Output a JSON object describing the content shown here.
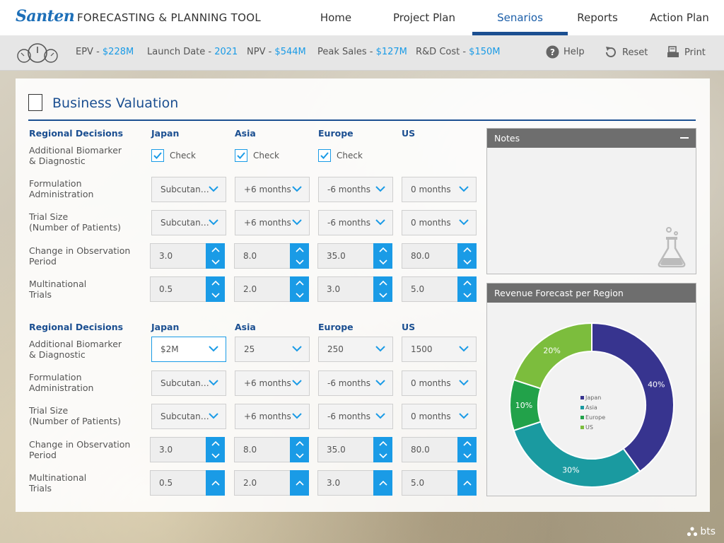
{
  "brand": {
    "logo_text": "Santen",
    "app_title": "FORECASTING & PLANNING TOOL"
  },
  "nav": {
    "items": [
      {
        "label": "Home"
      },
      {
        "label": "Project Plan"
      },
      {
        "label": "Senarios",
        "active": true
      },
      {
        "label": "Reports"
      },
      {
        "label": "Action Plan"
      }
    ]
  },
  "kpis": {
    "epv": {
      "label": "EPV - ",
      "value": "$228M"
    },
    "launch": {
      "label": "Launch Date - ",
      "value": "2021"
    },
    "npv": {
      "label": "NPV - ",
      "value": "$544M"
    },
    "peak": {
      "label": "Peak Sales - ",
      "value": "$127M"
    },
    "rd": {
      "label": "R&D Cost - ",
      "value": "$150M"
    }
  },
  "tools": {
    "help": "Help",
    "reset": "Reset",
    "print": "Print"
  },
  "section": {
    "title": "Business Valuation"
  },
  "block1": {
    "header": "Regional Decisions",
    "regions": [
      "Japan",
      "Asia",
      "Europe",
      "US"
    ],
    "rows": {
      "biomarker": "Additional Biomarker\n& Diagnostic",
      "formulation": "Formulation\nAdministration",
      "trial_size": "Trial Size\n(Number of Patients)",
      "observation": "Change in Observation\nPeriod",
      "multinational": "Multinational\nTrials"
    },
    "check_label": "Check",
    "formulation": [
      "Subcutane…",
      "+6 months",
      "-6 months",
      "0 months"
    ],
    "trial_size": [
      "Subcutane…",
      "+6 months",
      "-6 months",
      "0 months"
    ],
    "observation": [
      "3.0",
      "8.0",
      "35.0",
      "80.0"
    ],
    "multinational": [
      "0.5",
      "2.0",
      "3.0",
      "5.0"
    ]
  },
  "block2": {
    "header": "Regional Decisions",
    "regions": [
      "Japan",
      "Asia",
      "Europe",
      "US"
    ],
    "rows": {
      "biomarker": "Additional Biomarker\n& Diagnostic",
      "formulation": "Formulation\nAdministration",
      "trial_size": "Trial Size\n(Number of Patients)",
      "observation": "Change in Observation\nPeriod",
      "multinational": "Multinational\nTrials"
    },
    "biomarker": [
      "$2M",
      "25",
      "250",
      "1500"
    ],
    "formulation": [
      "Subcutane…",
      "+6 months",
      "-6 months",
      "0 months"
    ],
    "trial_size": [
      "Subcutane…",
      "+6 months",
      "-6 months",
      "0 months"
    ],
    "observation": [
      "3.0",
      "8.0",
      "35.0",
      "80.0"
    ],
    "multinational": [
      "0.5",
      "2.0",
      "3.0",
      "5.0"
    ]
  },
  "notes": {
    "title": "Notes"
  },
  "revenue": {
    "title": "Revenue Forecast per Region"
  },
  "chart_data": {
    "type": "pie",
    "style": "donut",
    "categories": [
      "Japan",
      "Asia",
      "Europe",
      "US"
    ],
    "values": [
      40,
      30,
      10,
      20
    ],
    "labels": [
      "40%",
      "30%",
      "10%",
      "20%"
    ],
    "colors": [
      "#37348f",
      "#1a9aa0",
      "#22a24a",
      "#7cbd3d"
    ],
    "legend_position": "center"
  },
  "footer": {
    "brand": "bts"
  }
}
